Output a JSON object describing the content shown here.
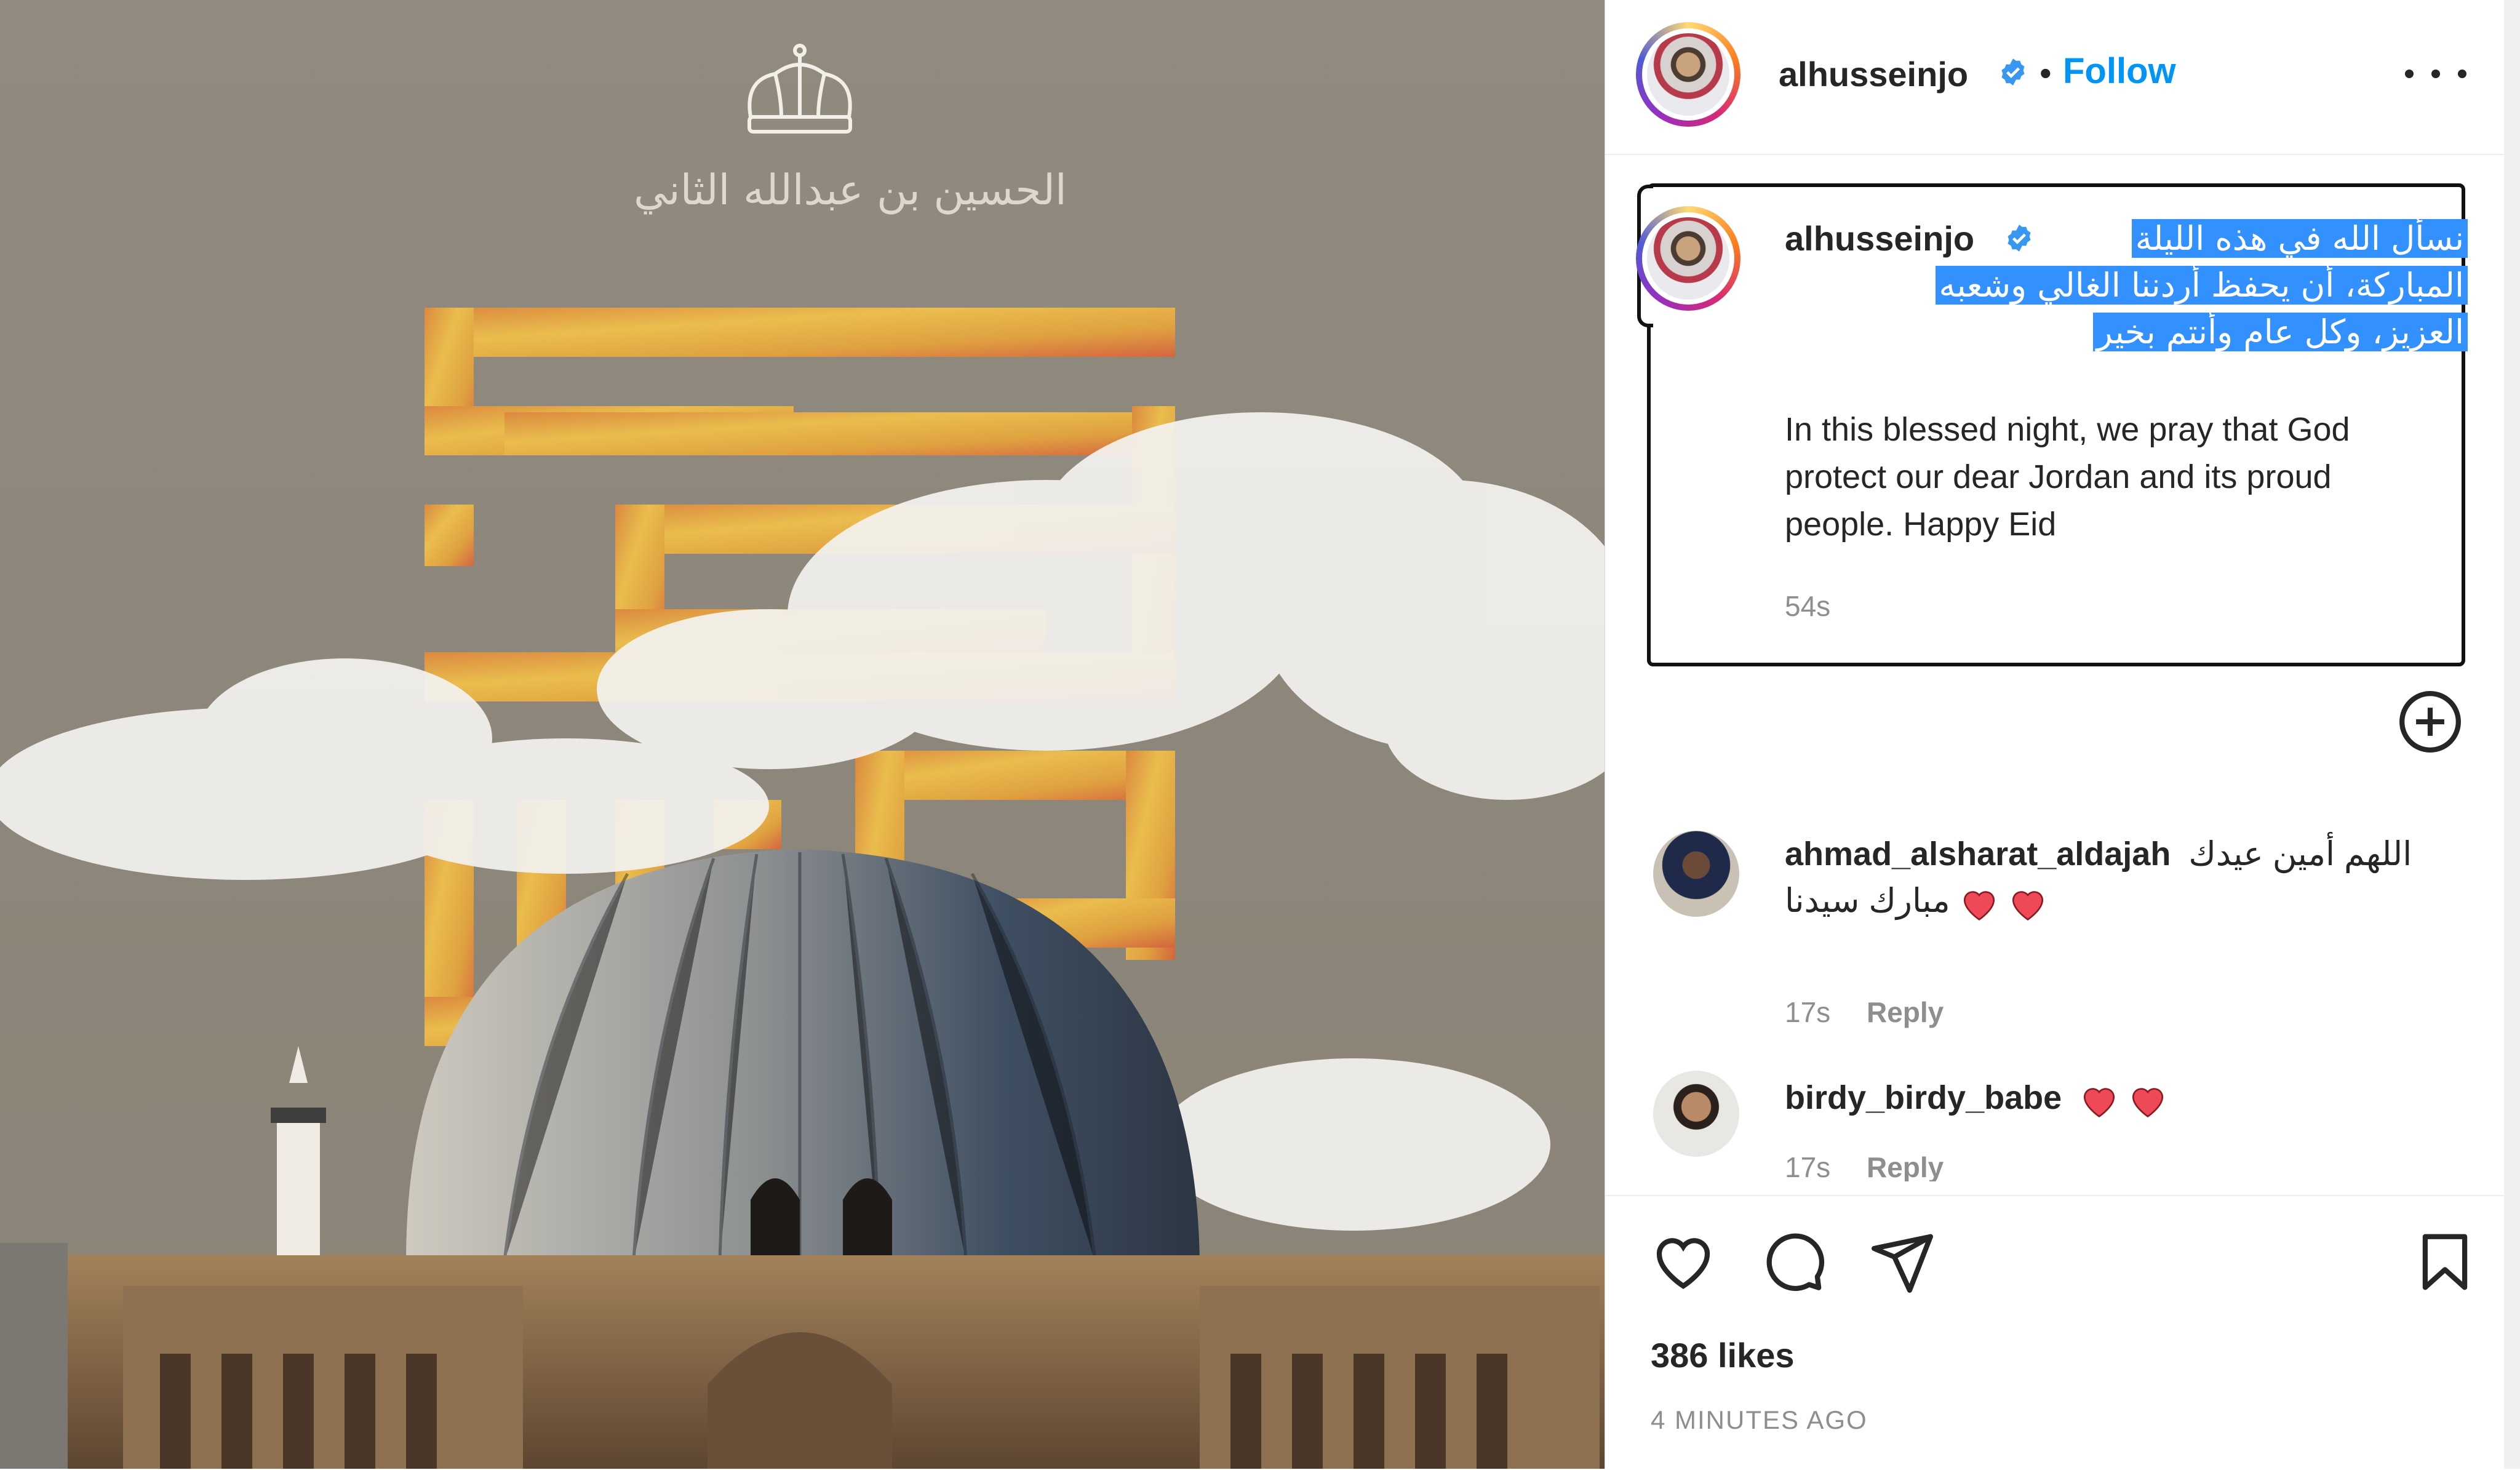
{
  "post": {
    "author": "alhusseinjo",
    "follow_label": "Follow",
    "separator": "•",
    "verified_icon": "verified-badge-icon",
    "more_icon": "more-options-icon",
    "image": {
      "signature_text": "الحسين بن عبدالله الثاني",
      "crown_icon": "crown-icon"
    }
  },
  "caption": {
    "author": "alhusseinjo",
    "arabic_lines": [
      "نسأل الله في هذه الليلة",
      "المباركة، أن يحفظ أردننا الغالي وشعبه",
      "العزيز، وكل عام وأنتم بخير"
    ],
    "english": "In this blessed night, we pray that God protect our dear Jordan and its proud people. Happy Eid",
    "time": "54s",
    "highlight_color": "#3390ff"
  },
  "load_more_icon": "plus-circle-icon",
  "comments": [
    {
      "user": "ahmad_alsharat_aldajah",
      "text": "اللهم أمين عيدك مبارك سيدنا",
      "time": "17s",
      "reply_label": "Reply"
    },
    {
      "user": "birdy_birdy_babe",
      "text": "",
      "time": "17s",
      "reply_label": "Reply"
    }
  ],
  "actions": {
    "like_icon": "heart-outline-icon",
    "comment_icon": "comment-icon",
    "share_icon": "send-icon",
    "save_icon": "bookmark-icon"
  },
  "likes_text": "386 likes",
  "posted_ago": "4 MINUTES AGO",
  "colors": {
    "link_blue": "#0095f6",
    "heart_red": "#ed4956",
    "muted_text": "#8e8e8e"
  }
}
